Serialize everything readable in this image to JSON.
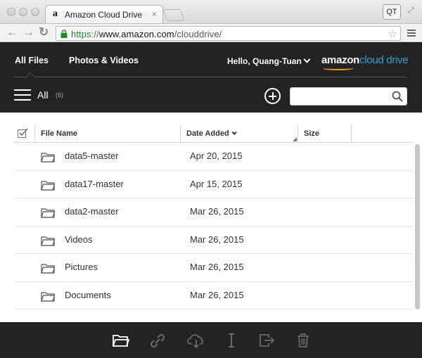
{
  "browser": {
    "tab_title": "Amazon Cloud Drive",
    "tab_favicon": "a",
    "tab_close": "×",
    "profile_label": "QT",
    "url_scheme": "https://",
    "url_host": "www.amazon.com",
    "url_path": "/clouddrive/",
    "back_glyph": "←",
    "forward_glyph": "→",
    "reload_glyph": "↻",
    "star_glyph": "☆",
    "fullscreen_glyph": "⤢"
  },
  "header": {
    "nav_all_files": "All Files",
    "nav_photos_videos": "Photos & Videos",
    "greeting": "Hello, Quang-Tuan",
    "logo_amazon": "amazon",
    "logo_cloud_drive": "cloud drive",
    "all_label": "All",
    "all_count": "(6)",
    "search_placeholder": ""
  },
  "table": {
    "columns": {
      "file_name": "File Name",
      "date_added": "Date Added",
      "size": "Size"
    },
    "rows": [
      {
        "name": "data5-master",
        "date": "Apr 20, 2015",
        "size": ""
      },
      {
        "name": "data17-master",
        "date": "Apr 15, 2015",
        "size": ""
      },
      {
        "name": "data2-master",
        "date": "Mar 26, 2015",
        "size": ""
      },
      {
        "name": "Videos",
        "date": "Mar 26, 2015",
        "size": ""
      },
      {
        "name": "Pictures",
        "date": "Mar 26, 2015",
        "size": ""
      },
      {
        "name": "Documents",
        "date": "Mar 26, 2015",
        "size": ""
      }
    ]
  },
  "colors": {
    "header_bg": "#232323",
    "url_scheme_green": "#1e8a1e",
    "logo_blue": "#2d9fd9",
    "logo_orange": "#f39b16",
    "icon_active": "#ffffff",
    "icon_disabled": "#6a6a6a"
  },
  "action_bar": [
    {
      "icon": "open-folder-icon",
      "enabled": true
    },
    {
      "icon": "link-icon",
      "enabled": false
    },
    {
      "icon": "cloud-download-icon",
      "enabled": false
    },
    {
      "icon": "rename-cursor-icon",
      "enabled": false
    },
    {
      "icon": "move-to-icon",
      "enabled": false
    },
    {
      "icon": "trash-icon",
      "enabled": false
    }
  ]
}
